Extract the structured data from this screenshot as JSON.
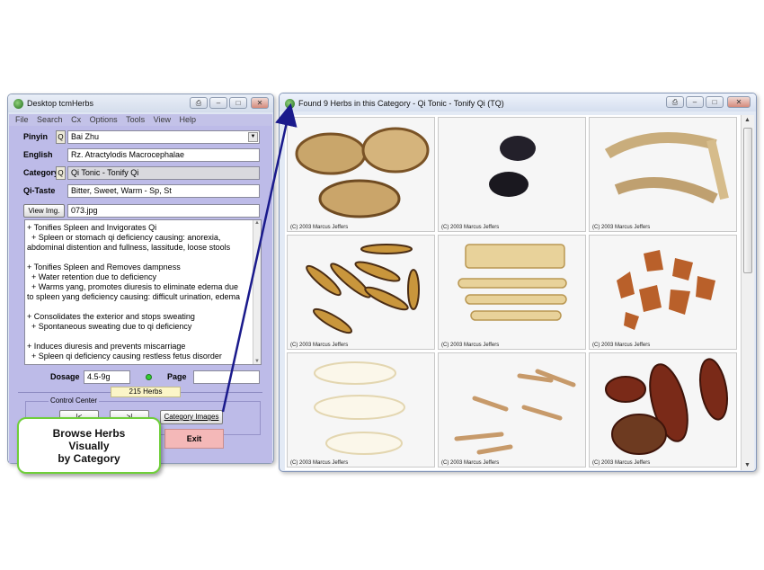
{
  "left_window": {
    "title": "Desktop tcmHerbs",
    "title_buttons": [
      "⎙",
      "–",
      "□",
      "✕"
    ],
    "menu": [
      "File",
      "Search",
      "Cx",
      "Options",
      "Tools",
      "View",
      "Help"
    ],
    "pinyin_label": "Pinyin",
    "pinyin_value": "Bai Zhu",
    "english_label": "English",
    "english_value": "Rz. Atractylodis Macrocephalae",
    "category_label": "Category",
    "category_value": "Qi Tonic - Tonify Qi",
    "qitaste_label": "Qi-Taste",
    "qitaste_value": "Bitter, Sweet, Warm - Sp, St",
    "q_button": "Q",
    "view_img_button": "View Img.",
    "image_file": "073.jpg",
    "description_lines": [
      "+ Tonifies Spleen and Invigorates Qi",
      "  + Spleen or stomach qi deficiency causing: anorexia,",
      "abdominal distention and fullness, lassitude, loose stools",
      "",
      "+ Tonifies Spleen and Removes dampness",
      "  + Water retention due to deficiency",
      "  + Warms yang, promotes diuresis to eliminate edema due",
      "to spleen yang deficiency causing: difficult urination, edema",
      "",
      "+ Consolidates the exterior and stops sweating",
      "  + Spontaneous sweating due to qi deficiency",
      "",
      "+ Induces diuresis and prevents miscarriage",
      "  + Spleen qi deficiency causing restless fetus disorder"
    ],
    "dosage_label": "Dosage",
    "dosage_value": "4.5-9g",
    "page_label": "Page",
    "page_value": "",
    "herb_count": "215 Herbs",
    "control_center_label": "Control Center",
    "first_button": "|<",
    "last_button": ">|",
    "category_images_button": "Category Images",
    "exit_button": "Exit",
    "callout_lines": [
      "Browse Herbs",
      "Visually",
      "by Category"
    ]
  },
  "right_window": {
    "title": "Found  9 Herbs in this Category - Qi Tonic - Tonify Qi (TQ)",
    "title_buttons": [
      "⎙",
      "–",
      "□",
      "✕"
    ],
    "scroll_up": "▲",
    "scroll_down": "▼",
    "images": [
      {
        "caption": "(C) 2003 Marcus Jeffers",
        "icon": "herb-slices-tan"
      },
      {
        "caption": "(C) 2003 Marcus Jeffers",
        "icon": "herb-black-dates"
      },
      {
        "caption": "(C) 2003 Marcus Jeffers",
        "icon": "herb-root-pieces"
      },
      {
        "caption": "(C) 2003 Marcus Jeffers",
        "icon": "herb-licorice-slices"
      },
      {
        "caption": "(C) 2003 Marcus Jeffers",
        "icon": "herb-pale-strips"
      },
      {
        "caption": "(C) 2003 Marcus Jeffers",
        "icon": "herb-amber-pieces"
      },
      {
        "caption": "(C) 2003 Marcus Jeffers",
        "icon": "herb-white-slices"
      },
      {
        "caption": "(C) 2003 Marcus Jeffers",
        "icon": "herb-thin-roots"
      },
      {
        "caption": "(C) 2003 Marcus Jeffers",
        "icon": "herb-red-slices"
      }
    ]
  },
  "colors": {
    "left_panel_bg": "#bdbbe8",
    "callout_border": "#6fcf3a",
    "arrow": "#1a1a8c",
    "exit_bg": "#f4b8b8"
  }
}
